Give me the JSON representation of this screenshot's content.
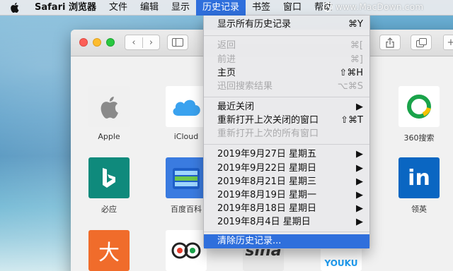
{
  "menubar": {
    "app_name": "Safari 浏览器",
    "items": [
      "文件",
      "编辑",
      "显示",
      "历史记录",
      "书签",
      "窗口",
      "帮助"
    ],
    "watermark": "www.MacDown.com"
  },
  "favorites": [
    {
      "label": "Apple",
      "icon": "apple-logo-icon",
      "color": "#f0f0f0"
    },
    {
      "label": "iCloud",
      "icon": "cloud-icon",
      "color": "#ffffff"
    },
    {
      "label": "360搜索",
      "icon": "360-logo-icon",
      "color": "#ffffff"
    },
    {
      "label": "必应",
      "icon": "bing-logo-icon",
      "color": "#0f8a7c"
    },
    {
      "label": "百度百科",
      "icon": "book-icon",
      "color": "#3a7be0"
    },
    {
      "label": "领英",
      "icon": "linkedin-logo-icon",
      "color": "#0a66c2"
    },
    {
      "label": "",
      "text": "大",
      "icon": "dazhong-logo-icon",
      "color": "#f06c2b"
    },
    {
      "label": "",
      "icon": "owl-logo-icon",
      "color": "#ffffff"
    },
    {
      "label": "",
      "text": "sina",
      "icon": "sina-logo-icon",
      "color": "#e8e8e8"
    },
    {
      "label": "",
      "text": "YOUKU",
      "icon": "youku-logo-icon",
      "color": "#ffffff"
    }
  ],
  "history_menu": {
    "show_all": {
      "label": "显示所有历史记录",
      "shortcut": "⌘Y"
    },
    "back": {
      "label": "返回",
      "shortcut": "⌘["
    },
    "forward": {
      "label": "前进",
      "shortcut": "⌘]"
    },
    "home": {
      "label": "主页",
      "shortcut": "⇧⌘H"
    },
    "xunlei": {
      "label": "迅回搜索结果",
      "shortcut": "⌥⌘S"
    },
    "recently_closed": {
      "label": "最近关闭"
    },
    "reopen_last": {
      "label": "重新打开上次关闭的窗口",
      "shortcut": "⇧⌘T"
    },
    "reopen_all": {
      "label": "重新打开上次的所有窗口"
    },
    "dates": [
      "2019年9月27日 星期五",
      "2019年9月22日 星期日",
      "2019年8月21日 星期三",
      "2019年8月19日 星期一",
      "2019年8月18日 星期日",
      "2019年8月4日 星期日"
    ],
    "clear": {
      "label": "清除历史记录..."
    }
  },
  "colors": {
    "accent": "#2f6fdc"
  }
}
